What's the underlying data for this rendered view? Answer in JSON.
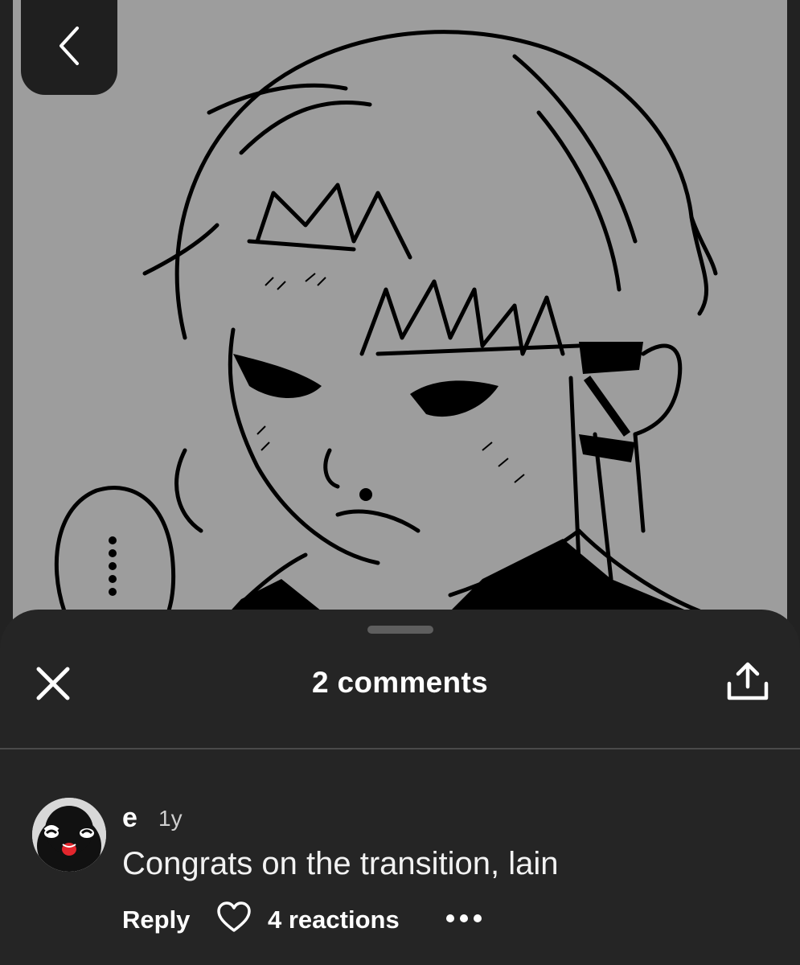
{
  "sheet": {
    "title": "2 comments"
  },
  "comment": {
    "author": "e",
    "time": "1y",
    "text": "Congrats on the transition, lain",
    "reply_label": "Reply",
    "reactions_label": "4 reactions"
  },
  "icons": {
    "back": "chevron-left-icon",
    "close": "close-icon",
    "share": "share-icon",
    "heart": "heart-icon",
    "more": "ellipsis-icon"
  },
  "colors": {
    "sheet_background": "#252525",
    "image_background": "#9d9d9d",
    "text": "#ffffff"
  }
}
